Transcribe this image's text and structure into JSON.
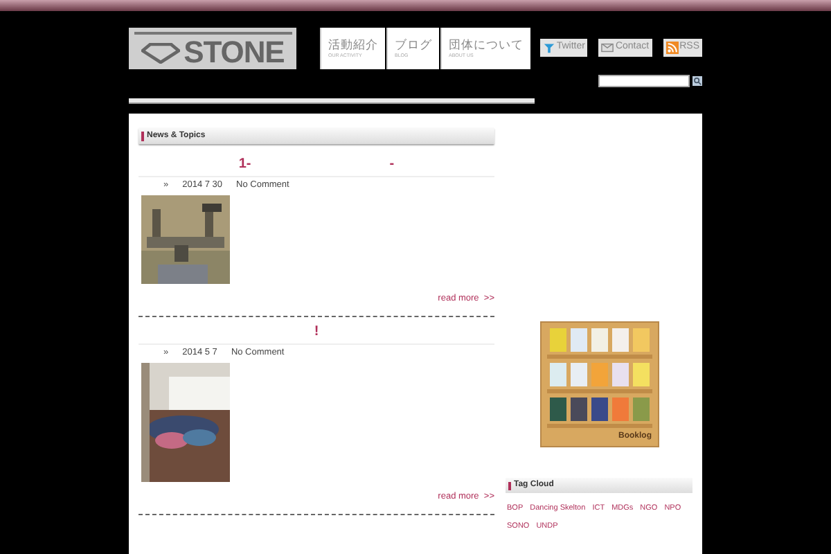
{
  "logo": {
    "text": "STONE"
  },
  "nav": [
    {
      "label": "活動紹介",
      "sub": "OUR ACTIVITY"
    },
    {
      "label": "ブログ",
      "sub": "BLOG"
    },
    {
      "label": "団体について",
      "sub": "ABOUT US"
    }
  ],
  "social_links": [
    {
      "label": "Twitter",
      "kind": "twitter"
    },
    {
      "label": "Contact",
      "kind": "mail"
    },
    {
      "label": "RSS",
      "kind": "rss"
    }
  ],
  "news": {
    "heading": "News & Topics",
    "posts": [
      {
        "title": [
          "1-",
          "-"
        ],
        "marker": "»",
        "date": "2014 7 30",
        "comments": "No Comment",
        "image": {
          "kind": "picture"
        },
        "read_more": "read more  >>"
      },
      {
        "title": [
          "!"
        ],
        "marker": "»",
        "date": "2014 5 7",
        "comments": "No Comment",
        "image": {
          "kind": "picture"
        },
        "read_more": "read more  >>"
      }
    ]
  },
  "sidebar": {
    "bookshelf_label": "Booklog",
    "tag_cloud": {
      "heading": "Tag Cloud",
      "tags": [
        "BOP",
        "Dancing Skelton",
        "ICT",
        "MDGs",
        "NGO",
        "NPO",
        "SONO",
        "UNDP"
      ]
    }
  }
}
